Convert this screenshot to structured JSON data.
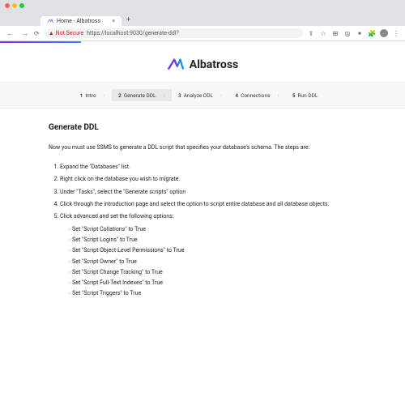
{
  "browser": {
    "tab_title": "Home - Albatross",
    "url_insecure": "Not Secure",
    "url_text": "https://localhost:9030/generate-ddl?",
    "plus": "+"
  },
  "app": {
    "name": "Albatross"
  },
  "stepper": [
    {
      "num": "1",
      "label": "Intro"
    },
    {
      "num": "2",
      "label": "Generate DDL"
    },
    {
      "num": "3",
      "label": "Analyze DDL"
    },
    {
      "num": "4",
      "label": "Connections"
    },
    {
      "num": "5",
      "label": "Run DDL"
    }
  ],
  "page": {
    "heading": "Generate DDL",
    "intro": "Now you must use SSMS to generate a DDL script that specifies your database's schema. The steps are:",
    "steps": [
      "Expand the \"Databases\" list.",
      "Right click on the database you wish to migrate.",
      "Under \"Tasks\", select the \"Generate scripts\" option",
      "Click through the introduction page and select the option to script entire database and all database objects.",
      "Click advanced and set the following options:"
    ],
    "substeps": [
      "Set \"Script Collations\" to True",
      "Set \"Script Logins\" to True",
      "Set \"Script Object-Level Permissions\" to True",
      "Set \"Script Owner\" to True",
      "Set \"Script Change Tracking\" to True",
      "Set \"Script Full-Text Indexes\" to True",
      "Set \"Script Triggers\" to True"
    ]
  }
}
